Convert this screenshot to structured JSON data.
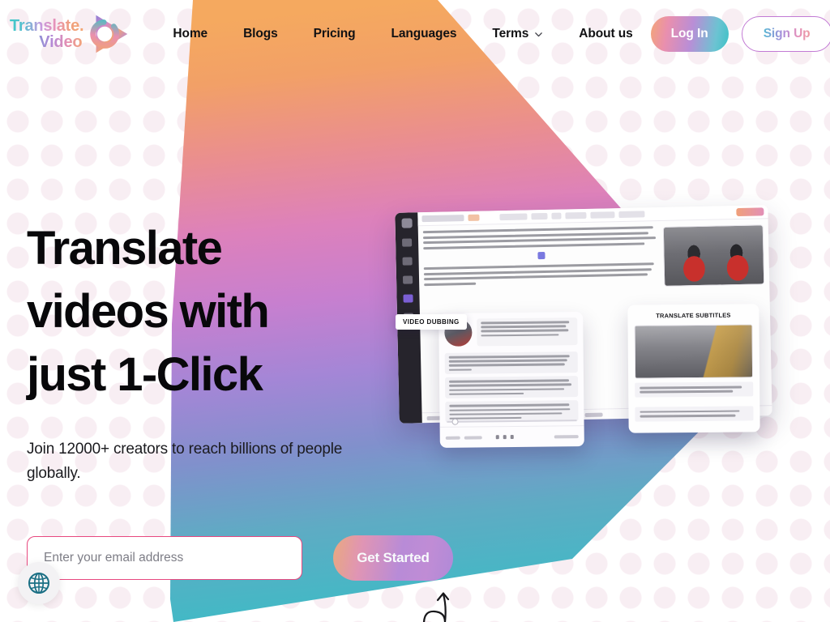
{
  "brand": {
    "logo_line1": "Translate.",
    "logo_line2": "Video",
    "logo_icon": "play-triangle-icon"
  },
  "nav": {
    "links": [
      {
        "label": "Home",
        "icon": null
      },
      {
        "label": "Blogs",
        "icon": null
      },
      {
        "label": "Pricing",
        "icon": null
      },
      {
        "label": "Languages",
        "icon": null
      },
      {
        "label": "Terms",
        "icon": "chevron-down-icon"
      },
      {
        "label": "About us",
        "icon": null
      }
    ],
    "login_label": "Log In",
    "signup_label": "Sign Up"
  },
  "hero": {
    "heading_line1": "Translate",
    "heading_line2": "videos with",
    "heading_line3": "just 1-Click",
    "subheading": "Join 12000+ creators to reach billions of people globally."
  },
  "form": {
    "email_placeholder": "Enter your email address",
    "email_value": "",
    "cta_label": "Get Started"
  },
  "widgets": {
    "language_globe_icon": "globe-icon",
    "doodle_icon": "curved-arrow-up-icon"
  },
  "mockups": {
    "video_dubbing_label": "VIDEO DUBBING",
    "translate_subtitles_label": "TRANSLATE SUBTITLES"
  },
  "colors": {
    "gradient_orange": "#f2a063",
    "gradient_pink": "#d47fbe",
    "gradient_purple": "#8f8fd0",
    "gradient_teal": "#3fbec6",
    "accent_pink": "#e8487f",
    "text_dark": "#08080a",
    "dot_pattern": "#e9c7d7"
  }
}
